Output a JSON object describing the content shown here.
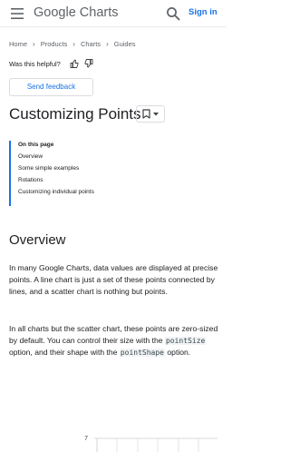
{
  "header": {
    "logo_google": "Google",
    "logo_product": "Charts",
    "signin_label": "Sign in",
    "icons": [
      "menu-icon",
      "search-icon"
    ]
  },
  "breadcrumb": [
    "Home",
    "Products",
    "Charts",
    "Guides"
  ],
  "helpful": {
    "label": "Was this helpful?"
  },
  "feedback_label": "Send feedback",
  "page_title": "Customizing Points",
  "toc": {
    "heading": "On this page",
    "items": [
      "Overview",
      "Some simple examples",
      "Rotations",
      "Customizing individual points"
    ]
  },
  "overview": {
    "title": "Overview",
    "p1": "In many Google Charts, data values are displayed at precise points. A line chart is just a set of these points connected by lines, and a scatter chart is nothing but points.",
    "p2_a": "In all charts but the scatter chart, these points are zero-sized by default. You can control their size with the ",
    "p2_code1": "pointSize",
    "p2_b": " option, and their shape with the ",
    "p2_code2": "pointShape",
    "p2_c": " option."
  },
  "chart_fragment": {
    "tick_label": "7"
  },
  "colors": {
    "accent": "#1a73e8",
    "text": "#202124",
    "muted": "#5f6368"
  }
}
